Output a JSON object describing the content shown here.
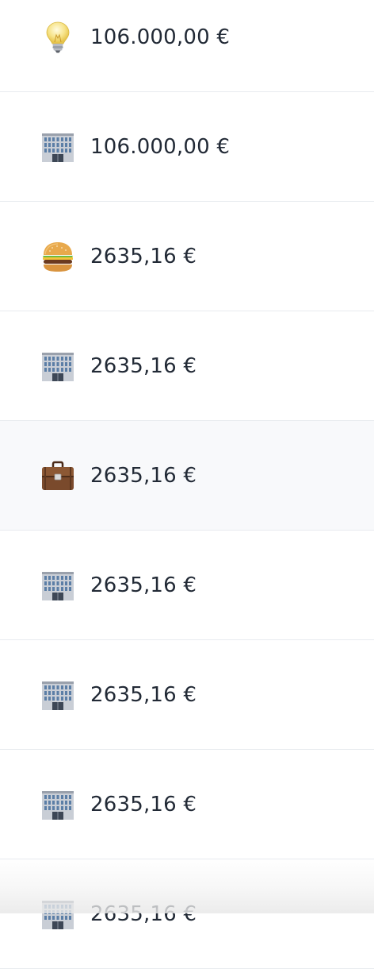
{
  "rows": [
    {
      "icon": "lightbulb-icon",
      "amount": "106.000,00 €"
    },
    {
      "icon": "office-building-icon",
      "amount": "106.000,00 €"
    },
    {
      "icon": "hamburger-icon",
      "amount": "2635,16 €"
    },
    {
      "icon": "office-building-icon",
      "amount": "2635,16 €"
    },
    {
      "icon": "briefcase-icon",
      "amount": "2635,16 €"
    },
    {
      "icon": "office-building-icon",
      "amount": "2635,16 €"
    },
    {
      "icon": "office-building-icon",
      "amount": "2635,16 €"
    },
    {
      "icon": "office-building-icon",
      "amount": "2635,16 €"
    },
    {
      "icon": "office-building-icon",
      "amount": "2635,16 €"
    }
  ]
}
